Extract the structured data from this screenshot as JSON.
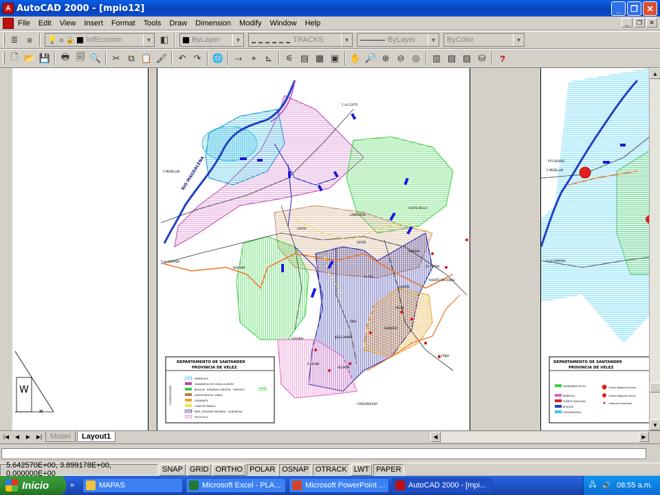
{
  "window": {
    "title": "AutoCAD 2000 - [mpio12]",
    "app_icon": "autocad-icon"
  },
  "menu": {
    "items": [
      "File",
      "Edit",
      "View",
      "Insert",
      "Format",
      "Tools",
      "Draw",
      "Dimension",
      "Modify",
      "Window",
      "Help"
    ]
  },
  "properties_toolbar": {
    "layer": "InfEconom",
    "color": "ByLayer",
    "linetype": "TRACKS",
    "lineweight": "ByLayer",
    "plotstyle": "ByColor"
  },
  "map": {
    "place_labels": [
      "5 LA COYTE",
      "5 MEDELLIN",
      "5 LA DORADA",
      "BOLIVAR",
      "CEPITA",
      "GUATE BELLO",
      "VELEZ",
      "LA PAZ",
      "PUENTE NACIONAL",
      "CHIPATA",
      "EL PEÑON",
      "SUCRE",
      "LANDAZURI",
      "GUEPSA",
      "JESUS MARIA",
      "CHIQUINQUIRA",
      "A TUNJA",
      "ALBANIA",
      "FLORIAN",
      "BARBOSA",
      "OIBA",
      "AGUADA"
    ],
    "river_label": "RIO MAGDALENA",
    "legend": {
      "title_line1": "DEPARTAMENTO DE SANTANDER",
      "title_line2": "PROVINCIA DE VELEZ",
      "side_label": "CONVENCIONES",
      "items": [
        "MINERALES",
        "GANADERIA DE CLIMA CALIENTE",
        "BOSQUE · RESERVA FORESTAL · PARQUES",
        "AGROFORESTAL SABAS",
        "GUAYABITA",
        "CAÑA DE PANELA",
        "PAPA, PEQUEÑA MEDIANA · GANADERIA",
        "FRUTICOLA"
      ]
    }
  },
  "right_map": {
    "place_labels": [
      "PTO BERRIO",
      "5 MEDELLIN",
      "5 LA DORADA"
    ],
    "legend_title_line1": "DEPARTAMENTO DE SANTANDER",
    "legend_title_line2": "PROVINCIA DE VELEZ",
    "legend_items": [
      "GANADERIA VELEZ",
      "BARBOSA",
      "PUENTE NACIONAL",
      "BOSQUE",
      "CHIQUINQUIRA"
    ],
    "convention_items": [
      "Centro Regional Primer",
      "Centro Regional Secun",
      "Cabecera Municipal"
    ]
  },
  "tabs": {
    "items": [
      "Model",
      "Layout1"
    ],
    "active": "Layout1"
  },
  "status": {
    "coordinates": "5.642570E+00, 3.899178E+00, 0.000000E+00",
    "buttons": [
      "SNAP",
      "GRID",
      "ORTHO",
      "POLAR",
      "OSNAP",
      "OTRACK",
      "LWT",
      "PAPER"
    ]
  },
  "taskbar": {
    "start_label": "Inicio",
    "tasks": [
      {
        "label": "MAPAS",
        "icon_color": "#f0c040"
      },
      {
        "label": "Microsoft Excel - PLA...",
        "icon_color": "#1f7a3a"
      },
      {
        "label": "Microsoft PowerPoint ...",
        "icon_color": "#d0452a"
      },
      {
        "label": "AutoCAD 2000 - [mpi...",
        "icon_color": "#c01010"
      }
    ],
    "clock": "08:55 a.m."
  },
  "colors": {
    "titlebar": "#0842b8",
    "taskbar": "#245edb",
    "start": "#2f8b2f"
  }
}
